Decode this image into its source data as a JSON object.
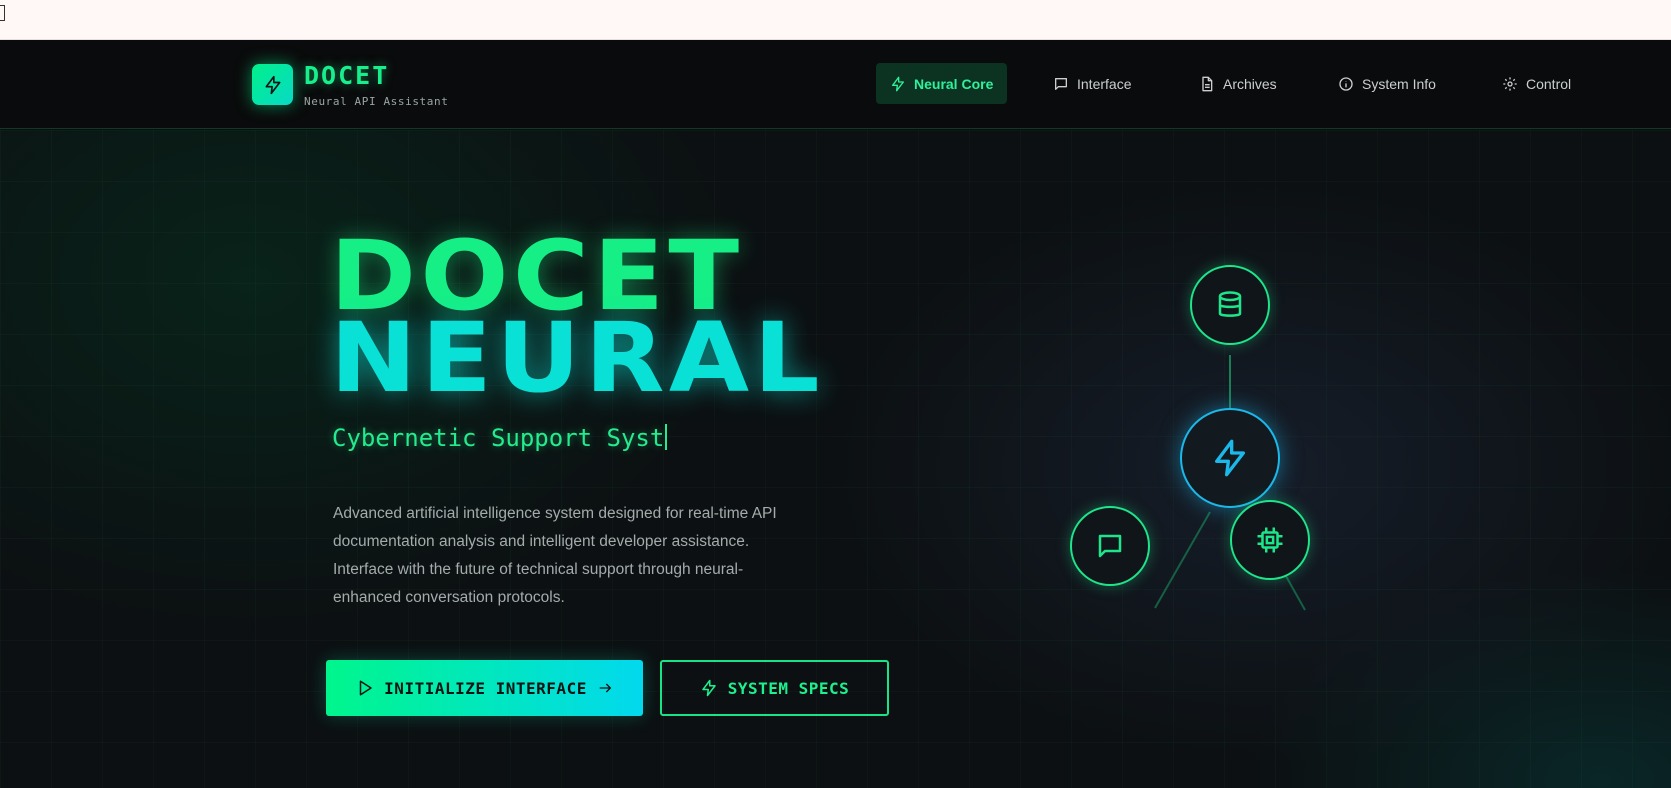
{
  "brand": {
    "title": "DOCET",
    "subtitle": "Neural API Assistant",
    "logo_icon": "lightning-icon"
  },
  "nav": {
    "items": [
      {
        "label": "Neural Core",
        "icon": "lightning-icon",
        "active": true
      },
      {
        "label": "Interface",
        "icon": "chat-icon",
        "active": false
      },
      {
        "label": "Archives",
        "icon": "document-icon",
        "active": false
      },
      {
        "label": "System Info",
        "icon": "info-icon",
        "active": false
      },
      {
        "label": "Control",
        "icon": "gear-icon",
        "active": false
      }
    ]
  },
  "hero": {
    "headline_line1": "DOCET",
    "headline_line2": "NEURAL",
    "tagline": "Cybernetic Support Syst",
    "description": "Advanced artificial intelligence system designed for real-time API documentation analysis and intelligent developer assistance. Interface with the future of technical support through neural-enhanced conversation protocols.",
    "primary_button": "INITIALIZE INTERFACE",
    "secondary_button": "SYSTEM SPECS"
  },
  "diagram": {
    "nodes": [
      "database-icon",
      "lightning-icon",
      "chat-icon",
      "chip-icon"
    ]
  },
  "colors": {
    "accent_green": "#16ef86",
    "accent_cyan": "#0ae1d6",
    "node_blue": "#1cb8ea",
    "background": "#0c1012"
  }
}
